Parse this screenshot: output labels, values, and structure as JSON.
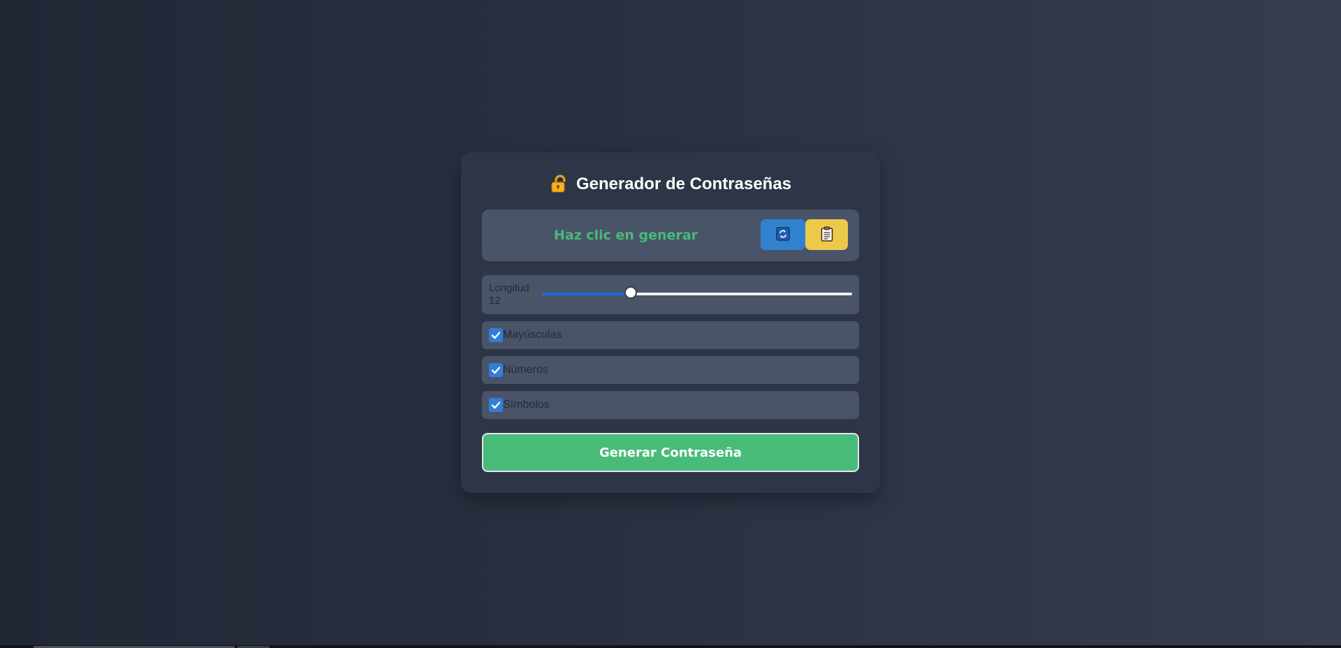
{
  "header": {
    "title": "Generador de Contraseñas",
    "icon": "locked-padlock-icon"
  },
  "output": {
    "placeholder_text": "Haz clic en generar",
    "refresh_icon": "refresh-icon",
    "copy_icon": "clipboard-icon",
    "text_color": "#48bb78"
  },
  "length": {
    "label": "Longitud",
    "value": "12",
    "min": 4,
    "max": 32,
    "current": 12
  },
  "options": [
    {
      "label": "Mayúsculas",
      "checked": true
    },
    {
      "label": "Números",
      "checked": true
    },
    {
      "label": "Símbolos",
      "checked": true
    }
  ],
  "actions": {
    "generate_label": "Generar Contraseña"
  },
  "colors": {
    "accent_green": "#48bb78",
    "refresh_blue": "#3182ce",
    "copy_yellow": "#ecc94b",
    "card_bg": "#2d3547",
    "panel_bg": "#4a5468"
  }
}
